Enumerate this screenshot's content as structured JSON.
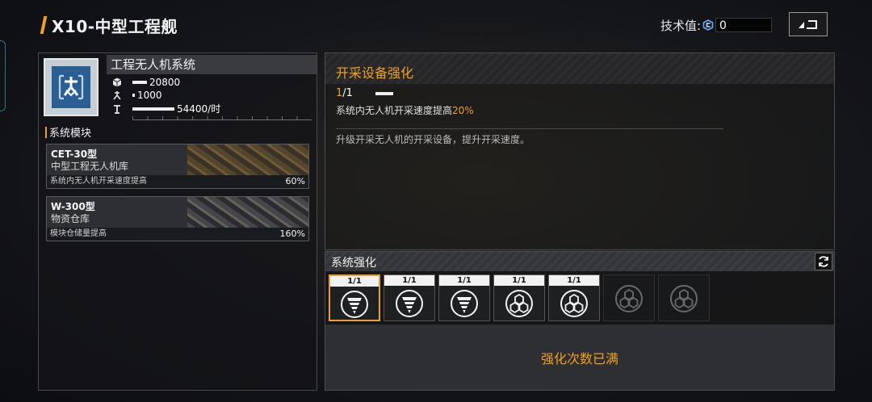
{
  "header": {
    "title": "X10-中型工程舰",
    "tech_label": "技术值:",
    "tech_value": "0"
  },
  "system": {
    "name": "工程无人机系统",
    "stats": [
      {
        "icon": "cube-icon",
        "value": "20800"
      },
      {
        "icon": "drone-icon",
        "value": "1000"
      },
      {
        "icon": "drill-icon",
        "value": "54400/时"
      }
    ]
  },
  "modules": {
    "section_label": "系统模块",
    "items": [
      {
        "title": "CET-30型",
        "subtitle": "中型工程无人机库",
        "effect": "系统内无人机开采速度提高",
        "percent": "60%"
      },
      {
        "title": "W-300型",
        "subtitle": "物资仓库",
        "effect": "模块仓储量提高",
        "percent": "160%"
      }
    ]
  },
  "upgrade": {
    "title": "开采设备强化",
    "level_current": "1",
    "level_sep": "/1",
    "effect_prefix": "系统内无人机开采速度提高",
    "effect_value": "20%",
    "description": "升级开采无人机的开采设备，提升开采速度。"
  },
  "enhancement": {
    "title": "系统强化",
    "slots": [
      {
        "level": "1/1",
        "icon": "drill-icon",
        "state": "active"
      },
      {
        "level": "1/1",
        "icon": "drill-icon",
        "state": "done"
      },
      {
        "level": "1/1",
        "icon": "drill-icon",
        "state": "done"
      },
      {
        "level": "1/1",
        "icon": "cubes-icon",
        "state": "done"
      },
      {
        "level": "1/1",
        "icon": "cubes-icon",
        "state": "done"
      },
      {
        "level": "",
        "icon": "cubes-icon",
        "state": "locked"
      },
      {
        "level": "",
        "icon": "cubes-icon",
        "state": "locked"
      }
    ],
    "max_text": "强化次数已满"
  },
  "colors": {
    "accent": "#f0a020",
    "panel_bg": "#141518",
    "icon_blue": "#2b5f93"
  }
}
